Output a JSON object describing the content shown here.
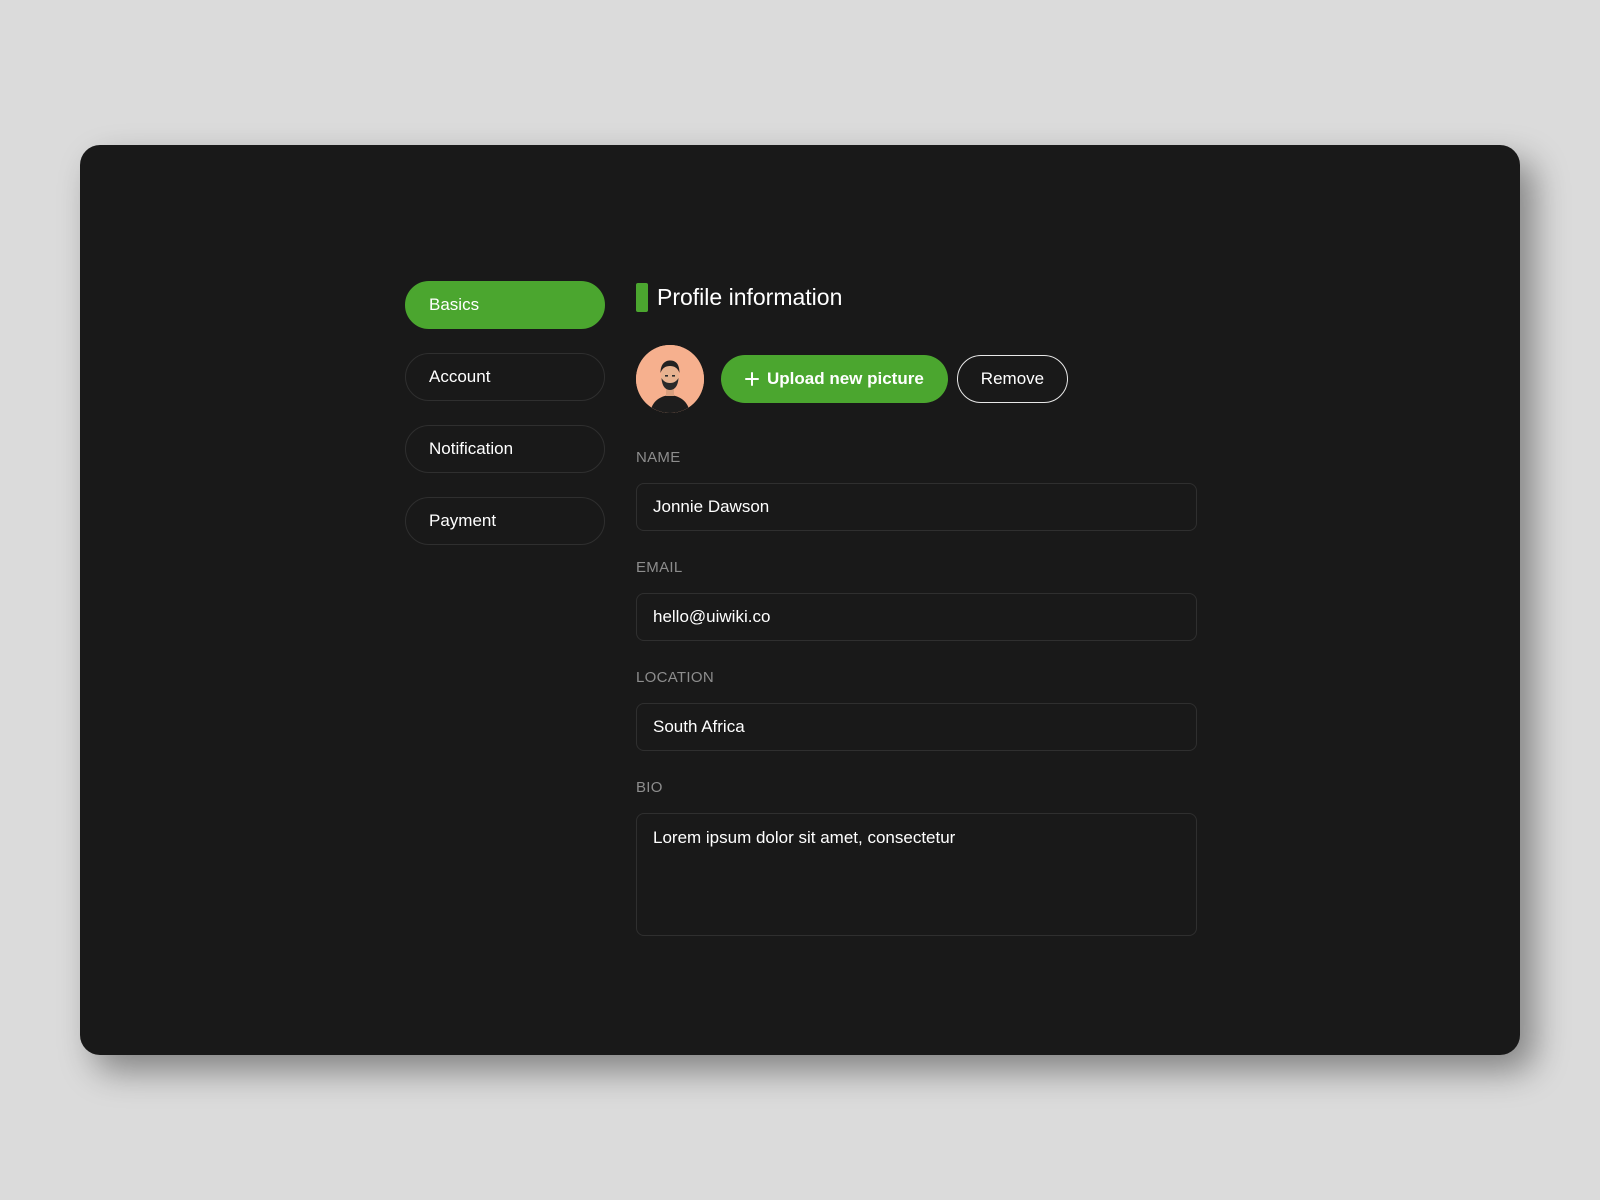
{
  "nav": {
    "items": [
      {
        "label": "Basics",
        "active": true
      },
      {
        "label": "Account",
        "active": false
      },
      {
        "label": "Notification",
        "active": false
      },
      {
        "label": "Payment",
        "active": false
      }
    ]
  },
  "profile": {
    "title": "Profile information",
    "upload_label": "Upload new picture",
    "remove_label": "Remove"
  },
  "form": {
    "name": {
      "label": "NAME",
      "value": "Jonnie Dawson"
    },
    "email": {
      "label": "EMAIL",
      "value": "hello@uiwiki.co"
    },
    "location": {
      "label": "LOCATION",
      "value": "South Africa"
    },
    "bio": {
      "label": "BIO",
      "value": "Lorem ipsum dolor sit amet, consectetur"
    }
  },
  "colors": {
    "accent": "#4ba62f",
    "card_background": "#191919",
    "page_background": "#dbdbdb",
    "avatar_background": "#f6b08e"
  },
  "icons": {
    "upload": "plus-icon",
    "avatar": "user-photo"
  }
}
